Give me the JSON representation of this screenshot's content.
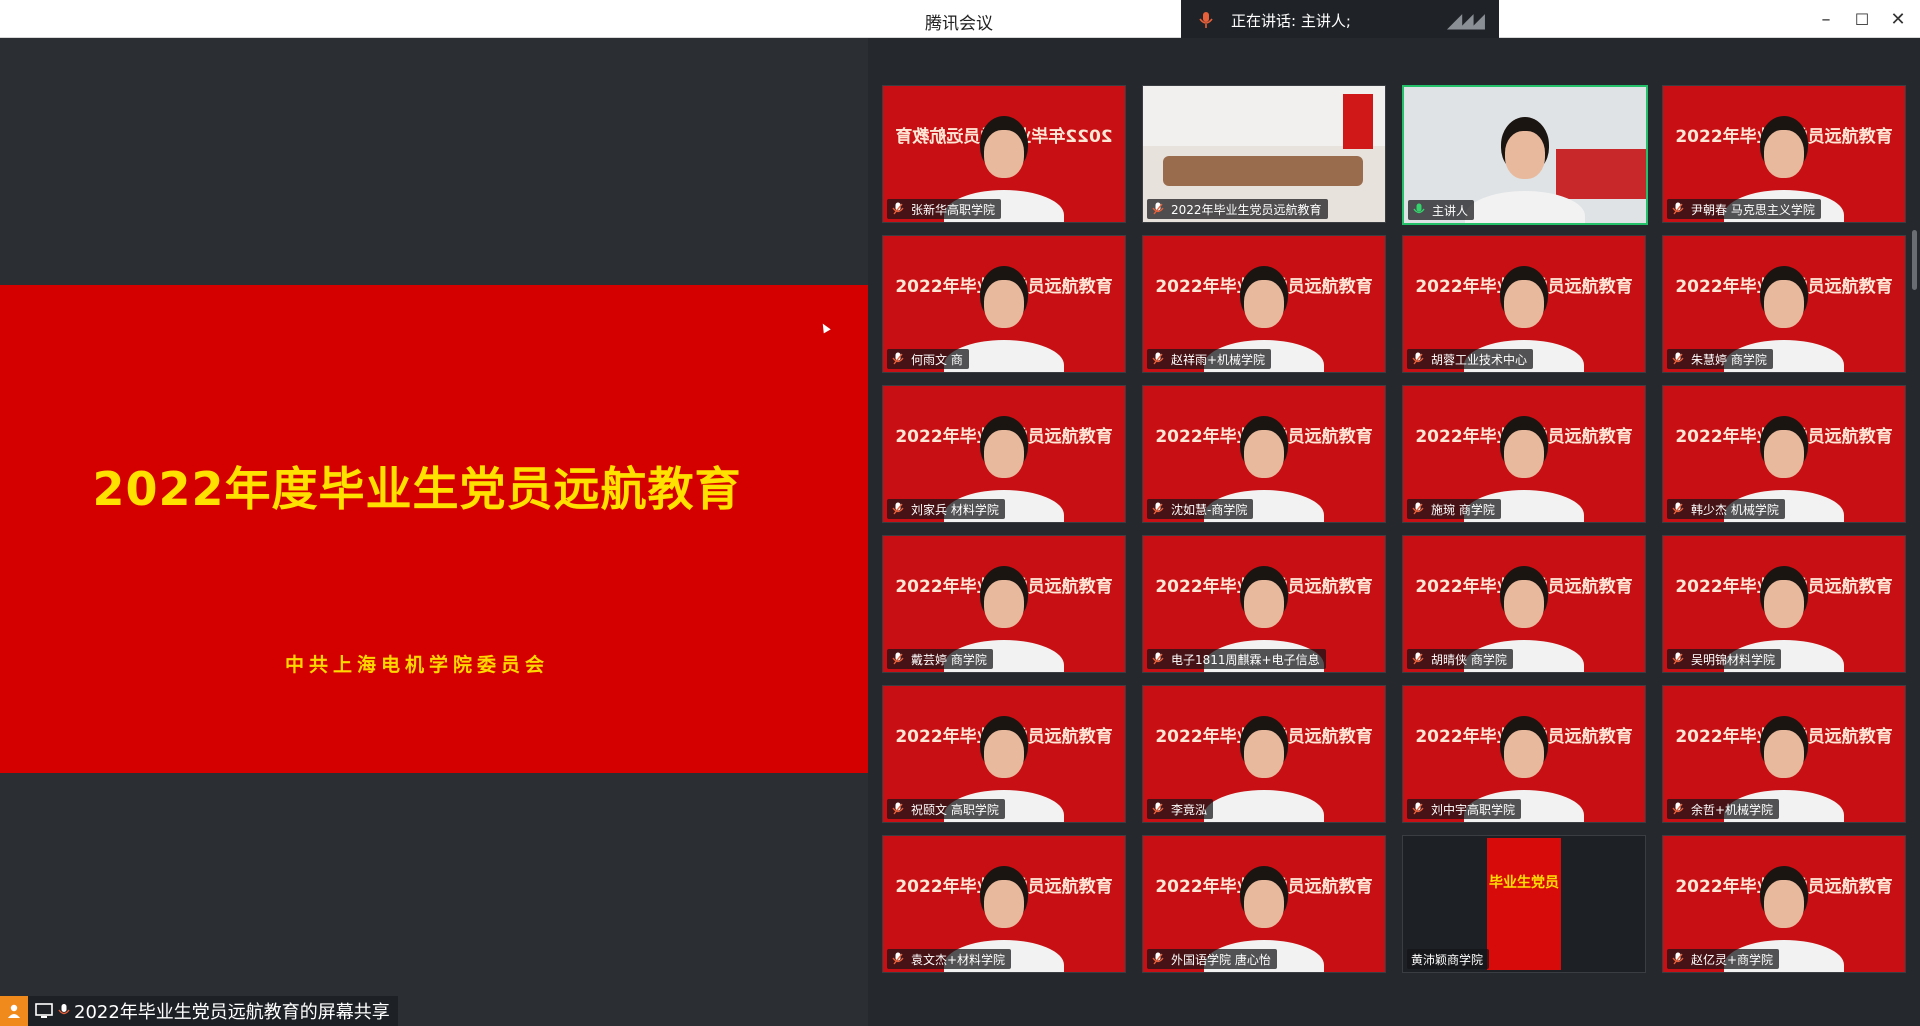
{
  "app": {
    "title": "腾讯会议",
    "speaking_text": "正在讲话: 主讲人;",
    "minimize": "–",
    "maximize": "☐",
    "close": "✕"
  },
  "slide": {
    "title": "2022年度毕业生党员远航教育",
    "subtitle": "中共上海电机学院委员会"
  },
  "share_tag": {
    "label": "2022年毕业生党员远航教育的屏幕共享"
  },
  "gallery": {
    "banner_text": "2022年毕业生党员远航教育",
    "mirrored_banner": "2022年毕业生党员远航教育",
    "mini_slide_title": "毕业生党员",
    "tiles": [
      {
        "name": "张新华高职学院",
        "kind": "person"
      },
      {
        "name": "2022年毕业生党员远航教育",
        "kind": "room"
      },
      {
        "name": "主讲人",
        "kind": "host"
      },
      {
        "name": "尹朝春  马克思主义学院",
        "kind": "person"
      },
      {
        "name": "何雨文 商",
        "kind": "person"
      },
      {
        "name": "赵祥雨+机械学院",
        "kind": "person"
      },
      {
        "name": "胡蓉工业技术中心",
        "kind": "person"
      },
      {
        "name": "朱慧婷 商学院",
        "kind": "person"
      },
      {
        "name": "刘家兵 材料学院",
        "kind": "person"
      },
      {
        "name": "沈如慧-商学院",
        "kind": "person"
      },
      {
        "name": "施琬 商学院",
        "kind": "person"
      },
      {
        "name": "韩少杰 机械学院",
        "kind": "person"
      },
      {
        "name": "戴芸婷 商学院",
        "kind": "person"
      },
      {
        "name": "电子1811周麒霖+电子信息",
        "kind": "person"
      },
      {
        "name": "胡晴侠 商学院",
        "kind": "person"
      },
      {
        "name": "吴明锦材料学院",
        "kind": "person"
      },
      {
        "name": "祝颐文 高职学院",
        "kind": "person"
      },
      {
        "name": "李竟泓",
        "kind": "person"
      },
      {
        "name": "刘中宇高职学院",
        "kind": "person"
      },
      {
        "name": "余哲+机械学院",
        "kind": "person"
      },
      {
        "name": "袁文杰+材料学院",
        "kind": "person"
      },
      {
        "name": "外国语学院 唐心怡",
        "kind": "person"
      },
      {
        "name": "黄沛颖商学院",
        "kind": "share"
      },
      {
        "name": "赵亿灵+商学院",
        "kind": "person"
      }
    ]
  },
  "colors": {
    "slide_red": "#d40000",
    "slide_title": "#ffe100",
    "active_speaker_border": "#25c16a"
  }
}
